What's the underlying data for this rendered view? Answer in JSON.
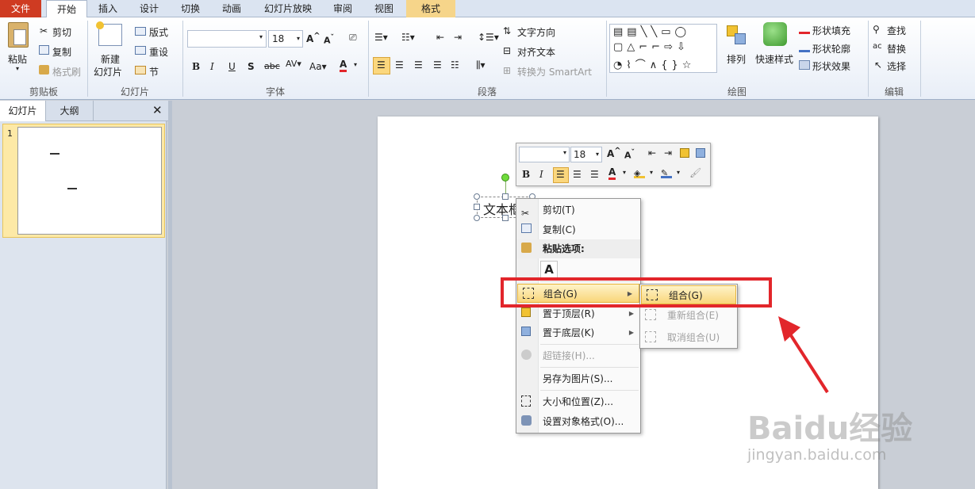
{
  "tabs": {
    "file": "文件",
    "home": "开始",
    "insert": "插入",
    "design": "设计",
    "transitions": "切换",
    "animations": "动画",
    "slideshow": "幻灯片放映",
    "review": "审阅",
    "view": "视图",
    "format": "格式"
  },
  "clipboard": {
    "paste": "粘贴",
    "cut": "剪切",
    "copy": "复制",
    "format_painter": "格式刷",
    "label": "剪贴板"
  },
  "slides": {
    "new_slide_line1": "新建",
    "new_slide_line2": "幻灯片",
    "layout": "版式",
    "reset": "重设",
    "section": "节",
    "label": "幻灯片"
  },
  "font": {
    "font_name": "",
    "font_size": "18",
    "label": "字体"
  },
  "paragraph": {
    "text_direction": "文字方向",
    "align_text": "对齐文本",
    "convert_smartart": "转换为 SmartArt",
    "label": "段落"
  },
  "drawing": {
    "arrange": "排列",
    "quick_styles": "快速样式",
    "shape_fill": "形状填充",
    "shape_outline": "形状轮廓",
    "shape_effects": "形状效果",
    "label": "绘图"
  },
  "editing": {
    "find": "查找",
    "replace": "替换",
    "select": "选择",
    "label": "编辑"
  },
  "pane": {
    "tab_slides": "幻灯片",
    "tab_outline": "大纲",
    "slide_number": "1"
  },
  "slide": {
    "textbox_text": "文本框"
  },
  "mini_toolbar": {
    "font_size": "18"
  },
  "context_menu": {
    "cut": "剪切(T)",
    "copy": "复制(C)",
    "paste_options": "粘贴选项:",
    "paste_keep_text": "A",
    "group": "组合(G)",
    "bring_to_front": "置于顶层(R)",
    "send_to_back": "置于底层(K)",
    "hyperlink": "超链接(H)...",
    "save_as_picture": "另存为图片(S)...",
    "size_position": "大小和位置(Z)...",
    "format_object": "设置对象格式(O)..."
  },
  "submenu": {
    "group": "组合(G)",
    "regroup": "重新组合(E)",
    "ungroup": "取消组合(U)"
  },
  "watermark": {
    "brand": "Baidu经验",
    "url": "jingyan.baidu.com"
  },
  "colors": {
    "accent_red": "#e2262b",
    "file_tab": "#cf3b22",
    "highlight": "#f9d67a"
  }
}
